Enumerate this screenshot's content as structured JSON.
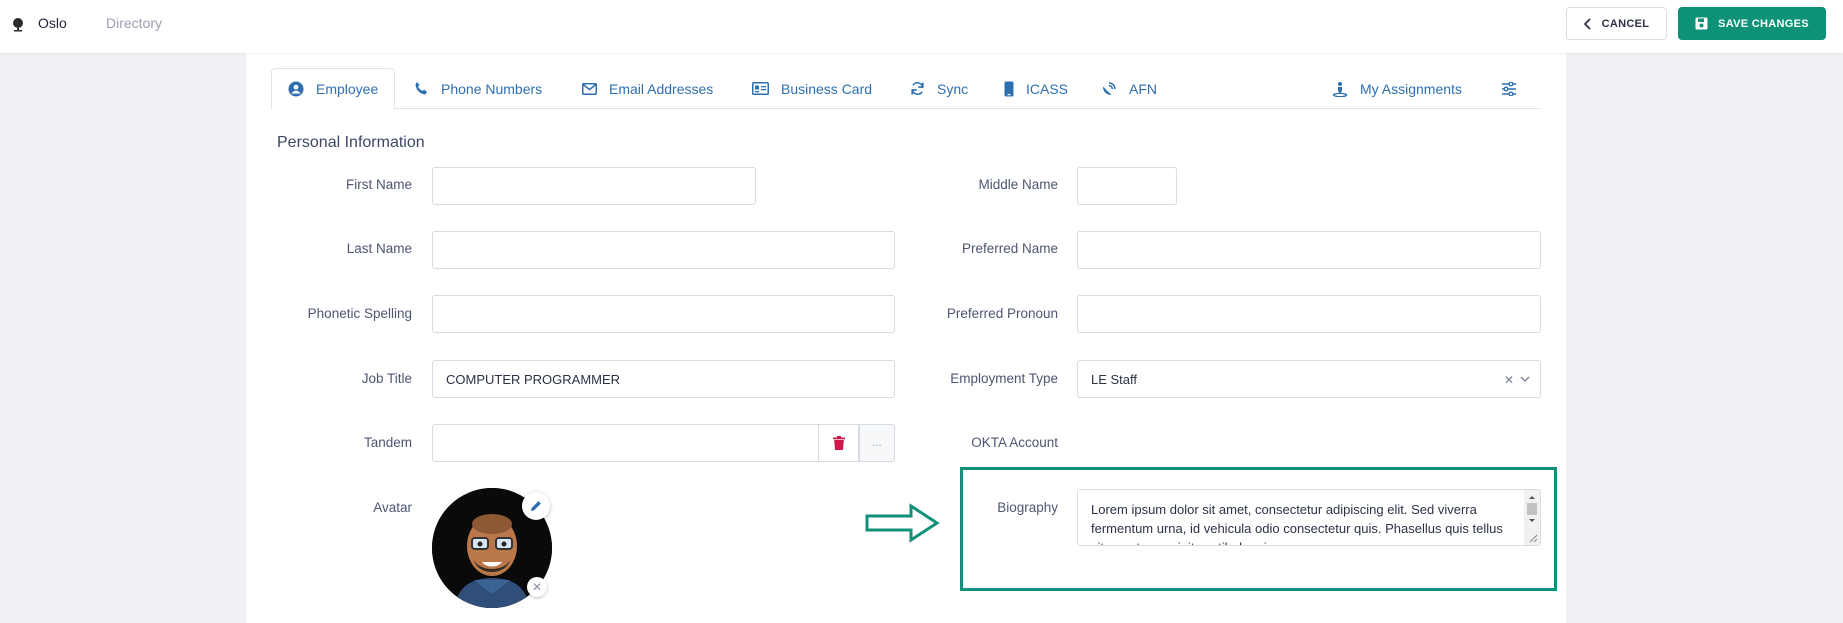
{
  "header": {
    "app_name": "Oslo",
    "breadcrumb": "Directory",
    "cancel_label": "CANCEL",
    "save_label": "SAVE CHANGES"
  },
  "tabs": [
    {
      "label": "Employee",
      "icon": "user-circle-icon",
      "active": true
    },
    {
      "label": "Phone Numbers",
      "icon": "phone-icon"
    },
    {
      "label": "Email Addresses",
      "icon": "envelope-icon"
    },
    {
      "label": "Business Card",
      "icon": "id-card-icon"
    },
    {
      "label": "Sync",
      "icon": "sync-icon"
    },
    {
      "label": "ICASS",
      "icon": "mobile-icon"
    },
    {
      "label": "AFN",
      "icon": "satellite-dish-icon"
    },
    {
      "label": "My Assignments",
      "icon": "person-pin-icon"
    }
  ],
  "section_title": "Personal Information",
  "form": {
    "first_name_label": "First Name",
    "first_name_value": "",
    "middle_name_label": "Middle Name",
    "middle_name_value": "",
    "last_name_label": "Last Name",
    "last_name_value": "",
    "preferred_name_label": "Preferred Name",
    "preferred_name_value": "",
    "phonetic_label": "Phonetic Spelling",
    "phonetic_value": "",
    "pronoun_label": "Preferred Pronoun",
    "pronoun_value": "",
    "job_title_label": "Job Title",
    "job_title_value": "COMPUTER PROGRAMMER",
    "employment_type_label": "Employment Type",
    "employment_type_value": "LE Staff",
    "tandem_label": "Tandem",
    "tandem_value": "",
    "more_label": "...",
    "okta_label": "OKTA Account",
    "okta_value": "",
    "avatar_label": "Avatar",
    "biography_label": "Biography",
    "biography_value": "Lorem ipsum dolor sit amet, consectetur adipiscing elit. Sed viverra fermentum urna, id vehicula odio consectetur quis. Phasellus quis tellus vitae ante suscipit vestibulum in."
  },
  "colors": {
    "accent": "#0e9277",
    "tab_text": "#2e6fb0",
    "delete": "#d1184a",
    "highlight": "#11917a"
  }
}
